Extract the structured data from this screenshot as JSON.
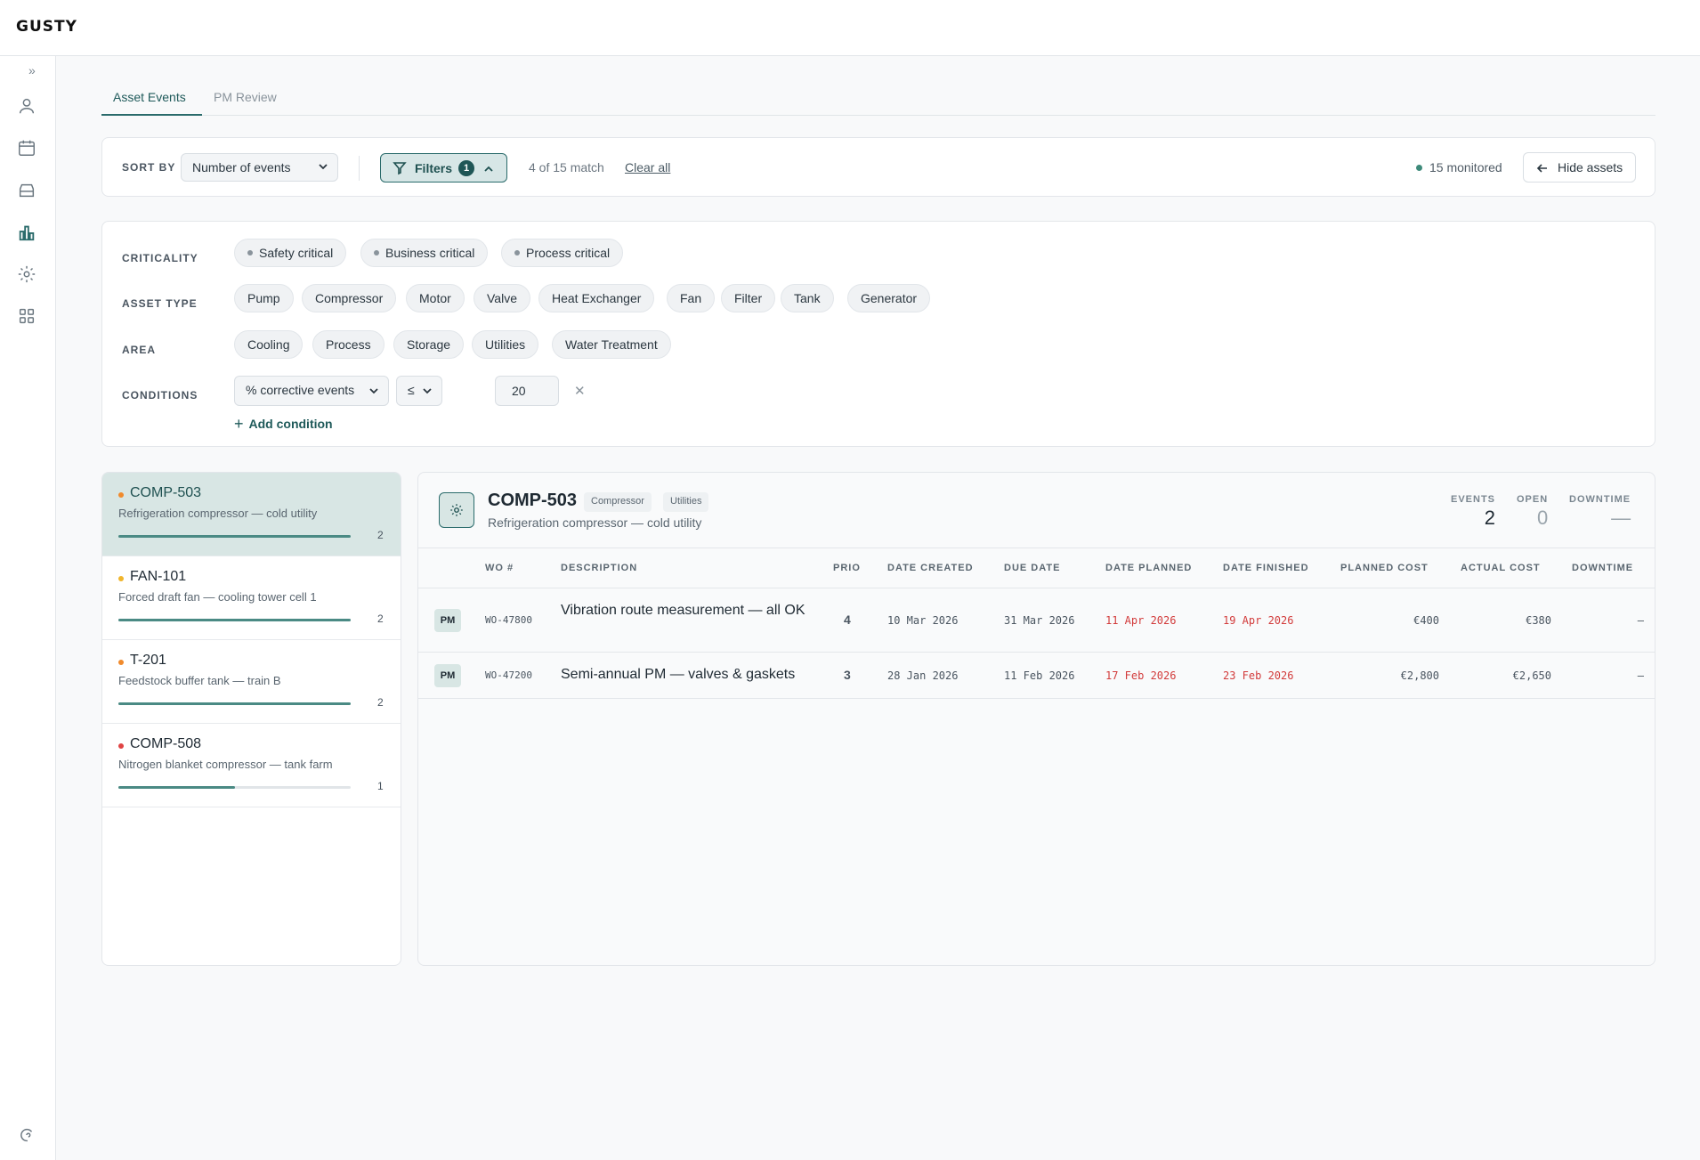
{
  "app": {
    "logo": "GUSTY"
  },
  "tabs": [
    {
      "label": "Asset Events"
    },
    {
      "label": "PM Review"
    }
  ],
  "sortbar": {
    "sort_label": "SORT BY",
    "sort_value": "Number of events",
    "filters_label": "Filters",
    "filters_count": "1",
    "match_text": "4 of 15 match",
    "clear_label": "Clear all",
    "monitored_text": "15 monitored",
    "hide_label": "Hide assets"
  },
  "filters": {
    "criticality": {
      "label": "CRITICALITY",
      "options": [
        "Safety critical",
        "Business critical",
        "Process critical"
      ]
    },
    "asset_type": {
      "label": "ASSET TYPE",
      "options": [
        "Pump",
        "Compressor",
        "Motor",
        "Valve",
        "Heat Exchanger",
        "Fan",
        "Filter",
        "Tank",
        "Generator"
      ]
    },
    "area": {
      "label": "AREA",
      "options": [
        "Cooling",
        "Process",
        "Storage",
        "Utilities",
        "Water Treatment"
      ]
    },
    "conditions": {
      "label": "CONDITIONS",
      "metric": "% corrective events",
      "operator": "≤",
      "value": "20",
      "add_label": "Add condition"
    }
  },
  "assets": [
    {
      "name": "COMP-503",
      "desc": "Refrigeration compressor — cold utility",
      "count": "2",
      "progress": 1.0,
      "dot_color": "#f08a2c",
      "selected": true
    },
    {
      "name": "FAN-101",
      "desc": "Forced draft fan — cooling tower cell 1",
      "count": "2",
      "progress": 1.0,
      "dot_color": "#f0b52c",
      "selected": false
    },
    {
      "name": "T-201",
      "desc": "Feedstock buffer tank — train B",
      "count": "2",
      "progress": 1.0,
      "dot_color": "#f08a2c",
      "selected": false
    },
    {
      "name": "COMP-508",
      "desc": "Nitrogen blanket compressor — tank farm",
      "count": "1",
      "progress": 0.5,
      "dot_color": "#e04444",
      "selected": false
    }
  ],
  "detail": {
    "icon": "gear-icon",
    "title": "COMP-503",
    "tags": [
      "Compressor",
      "Utilities"
    ],
    "subtitle": "Refrigeration compressor — cold utility",
    "stats": {
      "events_label": "EVENTS",
      "events": "2",
      "open_label": "OPEN",
      "open": "0",
      "downtime_label": "DOWNTIME",
      "downtime": "—"
    },
    "columns": [
      "WO #",
      "DESCRIPTION",
      "PRIO",
      "DATE CREATED",
      "DUE DATE",
      "DATE PLANNED",
      "DATE FINISHED",
      "PLANNED COST",
      "ACTUAL COST",
      "DOWNTIME"
    ],
    "rows": [
      {
        "type": "PM",
        "wo": "WO-47800",
        "description": "Vibration route measurement — all OK",
        "prio": "4",
        "created": "10 Mar 2026",
        "due": "31 Mar 2026",
        "planned": "11 Apr 2026",
        "finished": "19 Apr 2026",
        "planned_cost": "€400",
        "actual_cost": "€380",
        "downtime": "—"
      },
      {
        "type": "PM",
        "wo": "WO-47200",
        "description": "Semi-annual PM — valves & gaskets",
        "prio": "3",
        "created": "28 Jan 2026",
        "due": "11 Feb 2026",
        "planned": "17 Feb 2026",
        "finished": "23 Feb 2026",
        "planned_cost": "€2,800",
        "actual_cost": "€2,650",
        "downtime": "—"
      }
    ]
  },
  "colors": {
    "accent": "#2a6b6b",
    "late": "#d23b3b"
  }
}
